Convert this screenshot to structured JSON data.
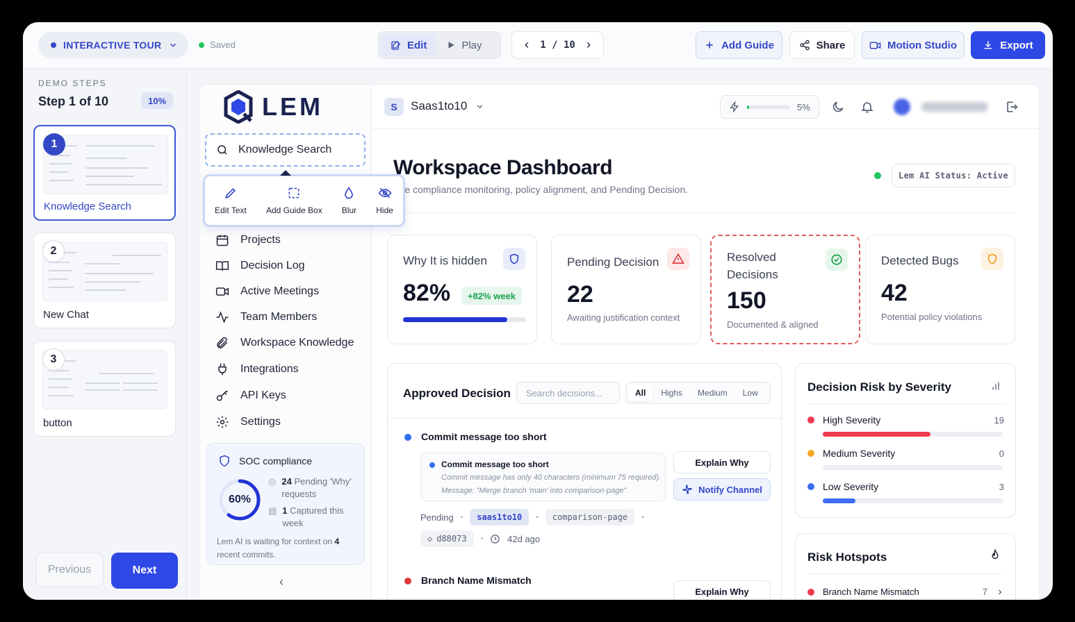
{
  "topbar": {
    "tour_label": "INTERACTIVE TOUR",
    "saved_label": "Saved",
    "edit_label": "Edit",
    "play_label": "Play",
    "page_current": "1",
    "page_sep": "/",
    "page_total": "10",
    "add_guide_label": "Add Guide",
    "share_label": "Share",
    "motion_studio_label": "Motion Studio",
    "export_label": "Export"
  },
  "steps_panel": {
    "heading": "DEMO STEPS",
    "progress_text": "Step 1 of 10",
    "percent": "10%",
    "steps": [
      {
        "number": "1",
        "label": "Knowledge Search"
      },
      {
        "number": "2",
        "label": "New Chat"
      },
      {
        "number": "3",
        "label": "button"
      }
    ],
    "previous_label": "Previous",
    "next_label": "Next"
  },
  "sidebar": {
    "logo_text": "LEM",
    "search_label": "Knowledge Search",
    "toolbar": {
      "edit_text": "Edit Text",
      "add_guide_box": "Add Guide Box",
      "blur": "Blur",
      "hide": "Hide"
    },
    "items": [
      {
        "label": "Projects",
        "icon": "calendar-icon"
      },
      {
        "label": "Decision Log",
        "icon": "book-icon"
      },
      {
        "label": "Active Meetings",
        "icon": "video-icon"
      },
      {
        "label": "Team Members",
        "icon": "activity-icon"
      },
      {
        "label": "Workspace Knowledge",
        "icon": "paperclip-icon"
      },
      {
        "label": "Integrations",
        "icon": "plug-icon"
      },
      {
        "label": "API Keys",
        "icon": "key-icon"
      },
      {
        "label": "Settings",
        "icon": "gear-icon"
      }
    ],
    "soc": {
      "title": "SOC compliance",
      "percent_label": "60%",
      "percent_value": 0.6,
      "pending_count": "24",
      "pending_text": "Pending 'Why' requests",
      "captured_count": "1",
      "captured_text": "Captured this week",
      "footer_prefix": "Lem AI is waiting for context on",
      "footer_count": "4",
      "footer_suffix": "recent commits."
    }
  },
  "header": {
    "workspace_initial": "S",
    "workspace_name": "Saas1to10",
    "usage_percent": "5%",
    "usage_value": 0.05
  },
  "dashboard": {
    "title": "Workspace Dashboard",
    "subtitle": "The compliance monitoring, policy alignment, and Pending Decision.",
    "status": "Lem AI Status: Active",
    "stats": [
      {
        "label": "Why It is hidden",
        "value": "82%",
        "badge": "+82% week",
        "progress": 0.85
      },
      {
        "label": "Pending Decision",
        "value": "22",
        "desc": "Awaiting justification context"
      },
      {
        "label_line1": "Resolved",
        "label_line2": "Decisions",
        "value": "150",
        "desc": "Documented & aligned"
      },
      {
        "label": "Detected Bugs",
        "value": "42",
        "desc": "Potential policy violations"
      }
    ]
  },
  "approved": {
    "title": "Approved Decision",
    "search_placeholder": "Search decisions...",
    "filters": [
      "All",
      "Highs",
      "Medium",
      "Low"
    ],
    "issue1": {
      "title": "Commit message too short",
      "detail_title": "Commit message too short",
      "detail_line1": "Commit message has only 40 characters (minimum 75 required).",
      "detail_line2": "Message: \"Merge branch 'main' into comparison-page\"",
      "explain_label": "Explain Why",
      "notify_label": "Notify Channel",
      "status": "Pending",
      "repo": "saas1to10",
      "branch": "comparison-page",
      "commit": "d88073",
      "age": "42d ago"
    },
    "issue2": {
      "title": "Branch Name Mismatch",
      "explain_label": "Explain Why"
    }
  },
  "risk": {
    "title": "Decision Risk by Severity",
    "rows": [
      {
        "label": "High Severity",
        "count": "19",
        "fill": 0.6,
        "color": "#ef3b4f"
      },
      {
        "label": "Medium Severity",
        "count": "0",
        "fill": 0,
        "color": "#f5a623"
      },
      {
        "label": "Low Severity",
        "count": "3",
        "fill": 0.18,
        "color": "#3b6ef0"
      }
    ]
  },
  "hotspots": {
    "title": "Risk Hotspots",
    "row_label": "Branch Name Mismatch",
    "row_count": "7"
  }
}
